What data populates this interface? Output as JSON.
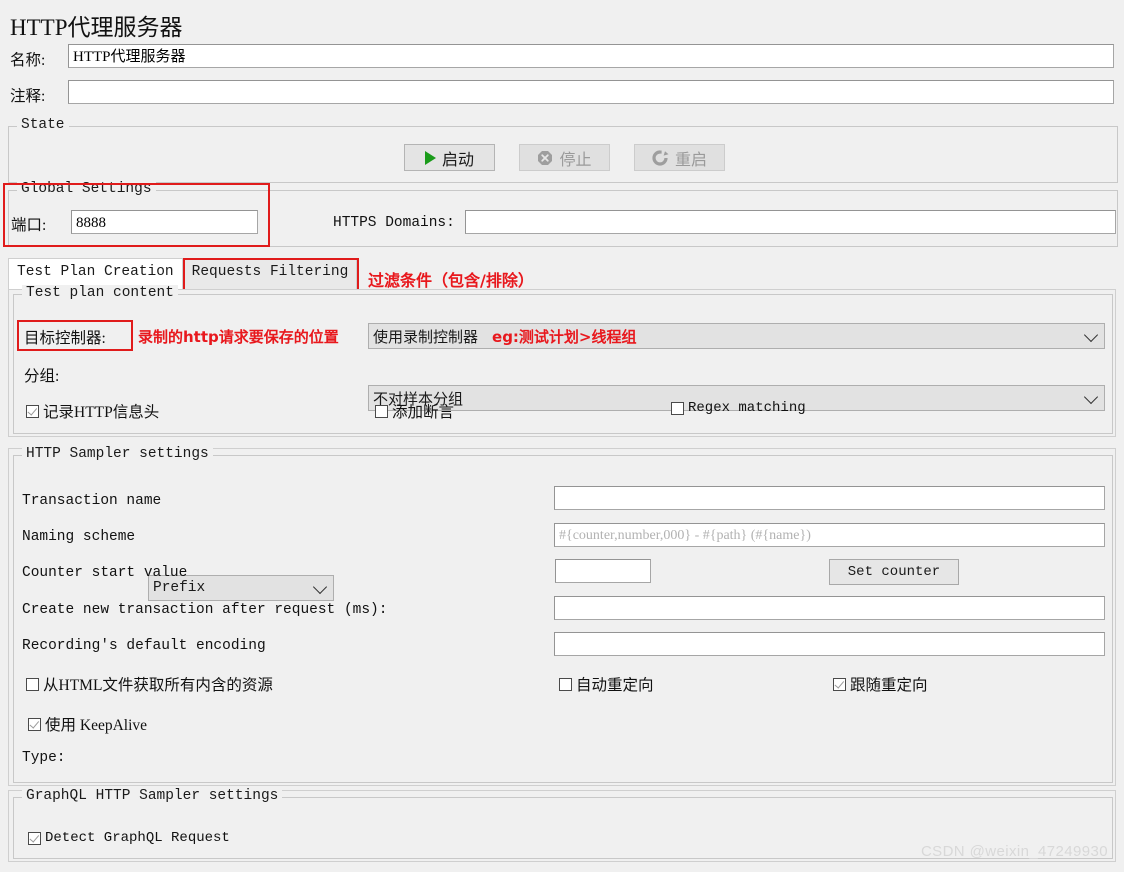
{
  "page": {
    "title": "HTTP代理服务器"
  },
  "form": {
    "name_label": "名称:",
    "name_value": "HTTP代理服务器",
    "comment_label": "注释:",
    "comment_value": ""
  },
  "state": {
    "legend": "State",
    "start_button": "启动",
    "stop_button": "停止",
    "restart_button": "重启",
    "start_icon": "play-triangle-icon",
    "stop_icon": "stop-octagon-icon",
    "restart_icon": "restart-arrow-icon"
  },
  "global_settings": {
    "legend": "Global Settings",
    "port_label": "端口:",
    "port_value": "8888",
    "https_domains_label": "HTTPS Domains:",
    "https_domains_value": ""
  },
  "tabs": [
    {
      "label": "Test Plan Creation",
      "active": true
    },
    {
      "label": "Requests Filtering",
      "active": false
    }
  ],
  "test_plan_content": {
    "legend": "Test plan content",
    "target_controller_label": "目标控制器:",
    "target_controller_value": "使用录制控制器",
    "grouping_label": "分组:",
    "grouping_value": "不对样本分组",
    "capture_headers_label": "记录HTTP信息头",
    "add_assertions_label": "添加断言",
    "regex_matching_label": "Regex matching"
  },
  "http_sampler_settings": {
    "legend": "HTTP Sampler settings",
    "transaction_name_label": "Transaction name",
    "transaction_name_value": "",
    "naming_scheme_label": "Naming scheme",
    "naming_scheme_value": "Prefix",
    "naming_pattern_placeholder": "#{counter,number,000} - #{path} (#{name})",
    "counter_start_label": "Counter start value",
    "counter_start_value": "",
    "set_counter_button": "Set counter",
    "create_new_transaction_label": "Create new transaction after request (ms):",
    "create_new_transaction_value": "",
    "default_encoding_label": "Recording's default encoding",
    "default_encoding_value": "",
    "retrieve_embedded_label": "从HTML文件获取所有内含的资源",
    "auto_redirect_label": "自动重定向",
    "follow_redirect_label": "跟随重定向",
    "keepalive_label": "使用 KeepAlive",
    "type_label": "Type:",
    "type_value": ""
  },
  "graphql_settings": {
    "legend": "GraphQL HTTP Sampler settings",
    "detect_label": "Detect GraphQL Request"
  },
  "annotations": {
    "filter_note": "过滤条件（包含/排除）",
    "target_controller_note": "录制的http请求要保存的位置",
    "controller_example_note": "eg:测试计划>线程组"
  },
  "watermark": "CSDN @weixin_47249930",
  "colors": {
    "annotation_red": "#e8181d",
    "start_green": "#1a9b1a",
    "background": "#f0f0f0"
  }
}
